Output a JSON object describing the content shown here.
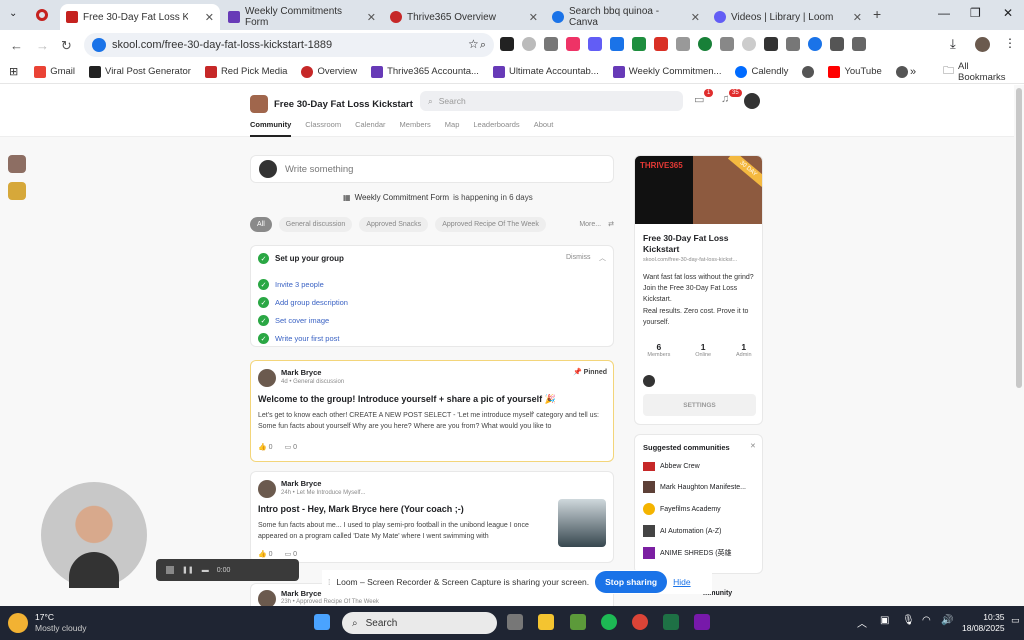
{
  "tabs": [
    {
      "title": "Free 30-Day Fat Loss Kicl",
      "active": true,
      "color": "#c5221f"
    },
    {
      "title": "Weekly Commitments Form",
      "color": "#673ab7"
    },
    {
      "title": "Thrive365 Overview",
      "color": "#c62828"
    },
    {
      "title": "Search bbq quinoa - Canva",
      "color": "#1a73e8"
    },
    {
      "title": "Videos | Library | Loom",
      "color": "#625df5"
    }
  ],
  "url": "skool.com/free-30-day-fat-loss-kickstart-1889",
  "bookmarks": [
    "Gmail",
    "Viral Post Generator",
    "Red Pick Media",
    "Overview",
    "Thrive365 Accounta...",
    "Ultimate Accountab...",
    "Weekly Commitmen...",
    "Calendly",
    "YouTube"
  ],
  "all_bookmarks": "All Bookmarks",
  "group": {
    "name": "Free 30-Day Fat Loss Kickstart",
    "search_placeholder": "Search",
    "chat_badge": "1",
    "notif_badge": "35"
  },
  "nav": [
    "Community",
    "Classroom",
    "Calendar",
    "Members",
    "Map",
    "Leaderboards",
    "About"
  ],
  "composer": {
    "placeholder": "Write something"
  },
  "event": {
    "name": "Weekly Commitment Form",
    "suffix": " is happening in 6 days"
  },
  "filters": {
    "all": "All",
    "items": [
      "General discussion",
      "Approved Snacks",
      "Approved Recipe Of The Week"
    ],
    "more": "More..."
  },
  "setup": {
    "title": "Set up your group",
    "dismiss": "Dismiss",
    "tasks": [
      "Invite 3 people",
      "Add group description",
      "Set cover image",
      "Write your first post"
    ]
  },
  "posts": [
    {
      "author": "Mark Bryce",
      "meta": "4d • General discussion",
      "pinned": "Pinned",
      "title": "Welcome to the group! Introduce yourself + share a pic of yourself 🎉",
      "body": "Let's get to know each other! CREATE A NEW POST SELECT - 'Let me introduce myself' category and tell us: Some fun facts about yourself Why are you here? Where are you from? What would you like to",
      "likes": "0",
      "comments": "0"
    },
    {
      "author": "Mark Bryce",
      "meta": "24h • Let Me Introduce Myself...",
      "title": "Intro post - Hey, Mark Bryce here (Your coach ;-)",
      "body": "Some fun facts about me... I used to play semi-pro football in the unibond league I once appeared on a program called 'Date My Mate' where I went swimming with",
      "likes": "0",
      "comments": "0"
    },
    {
      "author": "Mark Bryce",
      "meta": "23h • Approved Recipe Of The Week"
    }
  ],
  "side": {
    "banner": "THRIVE365",
    "ribbon": "30 DAY",
    "name": "Free 30-Day Fat Loss Kickstart",
    "url": "skool.com/free-30-day-fat-loss-kickst...",
    "desc": "Want fast fat loss without the grind? Join the Free 30-Day Fat Loss Kickstart.",
    "desc2": "Real results. Zero cost. Prove it to yourself.",
    "stats": [
      {
        "v": "6",
        "l": "Members"
      },
      {
        "v": "1",
        "l": "Online"
      },
      {
        "v": "1",
        "l": "Admin"
      }
    ],
    "settings": "SETTINGS"
  },
  "suggested": {
    "title": "Suggested communities",
    "items": [
      "Abbew Crew",
      "Mark Haughton Manifeste...",
      "Fayefilms Academy",
      "AI Automation (A-Z)",
      "ANIME SHREDS (英雄"
    ],
    "cut": "mmunity"
  },
  "loom": {
    "time": "0:00",
    "message": "Loom – Screen Recorder & Screen Capture is sharing your screen.",
    "stop": "Stop sharing",
    "hide": "Hide"
  },
  "weather": {
    "temp": "17°C",
    "desc": "Mostly cloudy"
  },
  "taskbar": {
    "search": "Search",
    "time": "10:35",
    "date": "18/08/2025"
  }
}
